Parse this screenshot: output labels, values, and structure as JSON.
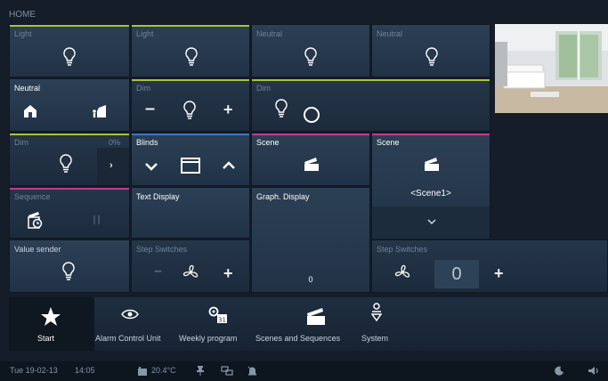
{
  "header": {
    "title": "HOME"
  },
  "tiles": {
    "light1": "Light",
    "light2": "Light",
    "neutral1": "Neutral",
    "neutral2": "Neutral",
    "neutral3": "Neutral",
    "dim1": "Dim",
    "dim2": "Dim",
    "dim3": "Dim",
    "dim3_percent": "0%",
    "blinds": "Blinds",
    "scene1": "Scene",
    "scene2": "Scene",
    "scene2_value": "<Scene1>",
    "sequence": "Sequence",
    "text_display": "Text Display",
    "graph_display": "Graph. Display",
    "graph_value": "0",
    "value_sender": "Value sender",
    "step1": "Step Switches",
    "step2": "Step Switches",
    "step2_value": "0"
  },
  "dock": {
    "start": "Start",
    "alarm": "Alarm Control Unit",
    "weekly": "Weekly program",
    "scenes": "Scenes and Sequences",
    "system": "System"
  },
  "status": {
    "date": "Tue 19-02-13",
    "time": "14:05",
    "temp": "20.4°C"
  },
  "colors": {
    "bar_green": "#a8c43a",
    "bar_blue": "#3e79c0",
    "bar_pink": "#c23d8c",
    "bar_gray": "#5a6b7d"
  }
}
